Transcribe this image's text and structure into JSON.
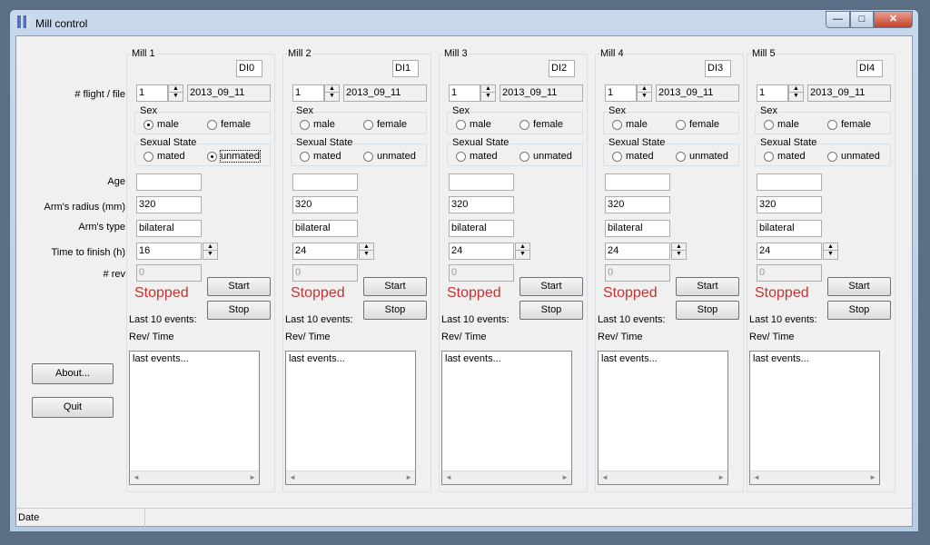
{
  "window": {
    "title": "Mill control",
    "minimize": "—",
    "maximize": "□",
    "close": "✕"
  },
  "labels": {
    "flight_file": "# flight / file",
    "age": "Age",
    "radius": "Arm's radius (mm)",
    "arm_type": "Arm's type",
    "time": "Time to finish (h)",
    "rev": "# rev"
  },
  "buttons": {
    "about": "About...",
    "quit": "Quit"
  },
  "status": {
    "date": "Date"
  },
  "colors": {
    "stopped": "#c83232"
  },
  "mills": [
    {
      "title": "Mill 1",
      "channel": "DI0",
      "flight": "1",
      "file": "2013_09_11",
      "sex_label": "Sex",
      "male": "male",
      "female": "female",
      "sex": "male",
      "state_label": "Sexual State",
      "mated": "mated",
      "unmated": "unmated",
      "state": "unmated",
      "age": "",
      "radius": "320",
      "arm_type": "bilateral",
      "time": "16",
      "rev": "0",
      "status": "Stopped",
      "start": "Start",
      "stop": "Stop",
      "events_label": "Last 10 events:",
      "rev_time": "Rev/ Time",
      "events": "last events..."
    },
    {
      "title": "Mill 2",
      "channel": "DI1",
      "flight": "1",
      "file": "2013_09_11",
      "sex_label": "Sex",
      "male": "male",
      "female": "female",
      "sex": "",
      "state_label": "Sexual State",
      "mated": "mated",
      "unmated": "unmated",
      "state": "",
      "age": "",
      "radius": "320",
      "arm_type": "bilateral",
      "time": "24",
      "rev": "0",
      "status": "Stopped",
      "start": "Start",
      "stop": "Stop",
      "events_label": "Last 10 events:",
      "rev_time": "Rev/ Time",
      "events": "last events..."
    },
    {
      "title": "Mill 3",
      "channel": "DI2",
      "flight": "1",
      "file": "2013_09_11",
      "sex_label": "Sex",
      "male": "male",
      "female": "female",
      "sex": "",
      "state_label": "Sexual State",
      "mated": "mated",
      "unmated": "unmated",
      "state": "",
      "age": "",
      "radius": "320",
      "arm_type": "bilateral",
      "time": "24",
      "rev": "0",
      "status": "Stopped",
      "start": "Start",
      "stop": "Stop",
      "events_label": "Last 10 events:",
      "rev_time": "Rev/ Time",
      "events": "last events..."
    },
    {
      "title": "Mill 4",
      "channel": "DI3",
      "flight": "1",
      "file": "2013_09_11",
      "sex_label": "Sex",
      "male": "male",
      "female": "female",
      "sex": "",
      "state_label": "Sexual State",
      "mated": "mated",
      "unmated": "unmated",
      "state": "",
      "age": "",
      "radius": "320",
      "arm_type": "bilateral",
      "time": "24",
      "rev": "0",
      "status": "Stopped",
      "start": "Start",
      "stop": "Stop",
      "events_label": "Last 10 events:",
      "rev_time": "Rev/ Time",
      "events": "last events..."
    },
    {
      "title": "Mill 5",
      "channel": "DI4",
      "flight": "1",
      "file": "2013_09_11",
      "sex_label": "Sex",
      "male": "male",
      "female": "female",
      "sex": "",
      "state_label": "Sexual State",
      "mated": "mated",
      "unmated": "unmated",
      "state": "",
      "age": "",
      "radius": "320",
      "arm_type": "bilateral",
      "time": "24",
      "rev": "0",
      "status": "Stopped",
      "start": "Start",
      "stop": "Stop",
      "events_label": "Last 10 events:",
      "rev_time": "Rev/ Time",
      "events": "last events..."
    }
  ]
}
